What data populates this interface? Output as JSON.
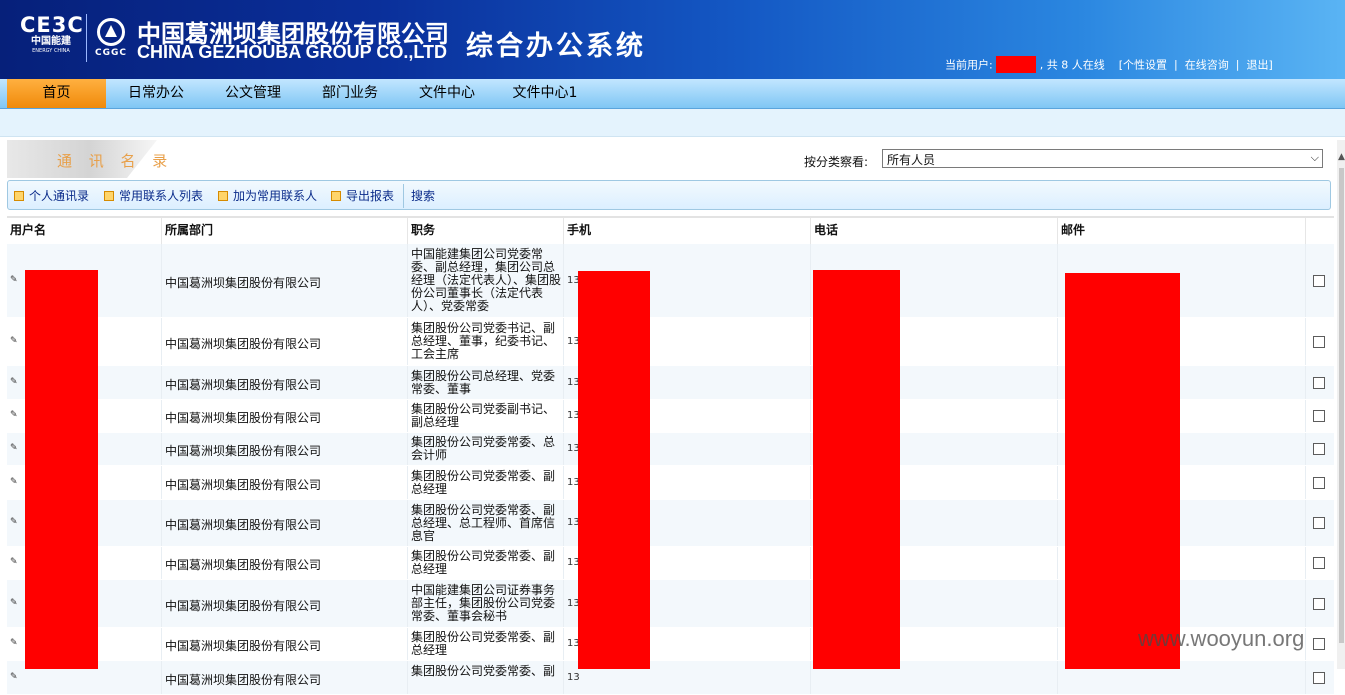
{
  "header": {
    "logo_mark": "CE3C",
    "logo_cn": "中国能建",
    "logo_en": "ENERGY CHINA",
    "emblem_text": "CGGC",
    "company_cn": "中国葛洲坝集团股份有限公司",
    "company_en": "CHINA GEZHOUBA GROUP CO.,LTD",
    "system_title": "综合办公系统",
    "current_user_label": "当前用户:",
    "online_count_text": ", 共 8 人在线",
    "links": [
      "[个性设置",
      "|",
      "在线咨询",
      "|",
      "退出]"
    ]
  },
  "nav": {
    "items": [
      "首页",
      "日常办公",
      "公文管理",
      "部门业务",
      "文件中心",
      "文件中心1"
    ],
    "active_index": 0
  },
  "module": {
    "title": "通 讯 名 录",
    "filter_label": "按分类察看:",
    "filter_value": "所有人员"
  },
  "toolbar": {
    "items": [
      "个人通讯录",
      "常用联系人列表",
      "加为常用联系人",
      "导出报表"
    ],
    "search_label": "搜索"
  },
  "table": {
    "headers": [
      "用户名",
      "所属部门",
      "职务",
      "手机",
      "电话",
      "邮件"
    ],
    "rows": [
      {
        "dept": "中国葛洲坝集团股份有限公司",
        "title": "中国能建集团公司党委常委、副总经理，集团公司总经理（法定代表人）、集团股份公司董事长（法定代表人）、党委常委",
        "phone_prefix": "13"
      },
      {
        "dept": "中国葛洲坝集团股份有限公司",
        "title": "集团股份公司党委书记、副总经理、董事，纪委书记、工会主席",
        "phone_prefix": "13"
      },
      {
        "dept": "中国葛洲坝集团股份有限公司",
        "title": "集团股份公司总经理、党委常委、董事",
        "phone_prefix": "13"
      },
      {
        "dept": "中国葛洲坝集团股份有限公司",
        "title": "集团股份公司党委副书记、副总经理",
        "phone_prefix": "13"
      },
      {
        "dept": "中国葛洲坝集团股份有限公司",
        "title": "集团股份公司党委常委、总会计师",
        "phone_prefix": "13"
      },
      {
        "dept": "中国葛洲坝集团股份有限公司",
        "title": "集团股份公司党委常委、副总经理",
        "phone_prefix": "13"
      },
      {
        "dept": "中国葛洲坝集团股份有限公司",
        "title": "集团股份公司党委常委、副总经理、总工程师、首席信息官",
        "phone_prefix": "13"
      },
      {
        "dept": "中国葛洲坝集团股份有限公司",
        "title": "集团股份公司党委常委、副总经理",
        "phone_prefix": "13"
      },
      {
        "dept": "中国葛洲坝集团股份有限公司",
        "title": "中国能建集团公司证券事务部主任，集团股份公司党委常委、董事会秘书",
        "phone_prefix": "13"
      },
      {
        "dept": "中国葛洲坝集团股份有限公司",
        "title": "集团股份公司党委常委、副总经理",
        "phone_prefix": "13"
      },
      {
        "dept": "中国葛洲坝集团股份有限公司",
        "title": "集团股份公司党委常委、副",
        "phone_prefix": "13"
      }
    ]
  },
  "watermark": "www.wooyun.org",
  "colors": {
    "header_dark": "#06207a",
    "nav_active": "#f08a0a",
    "redaction": "#ff0000",
    "module_title": "#e8a04a"
  }
}
